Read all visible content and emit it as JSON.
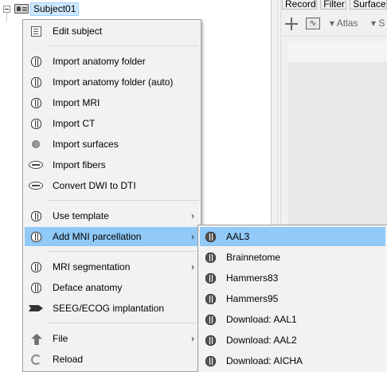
{
  "tree": {
    "subject_label": "Subject01"
  },
  "right_panel": {
    "tabs": [
      "Record",
      "Filter",
      "Surface"
    ],
    "toolbar": {
      "atlas_label": "Atlas",
      "more_label": "S"
    }
  },
  "context_menu": {
    "items": [
      {
        "label": "Edit subject",
        "icon": "edit-icon"
      },
      {
        "label": "Import anatomy folder",
        "icon": "brain-icon"
      },
      {
        "label": "Import anatomy folder (auto)",
        "icon": "brain-icon"
      },
      {
        "label": "Import MRI",
        "icon": "brain-icon"
      },
      {
        "label": "Import CT",
        "icon": "brain-ct-icon"
      },
      {
        "label": "Import surfaces",
        "icon": "surface-icon"
      },
      {
        "label": "Import fibers",
        "icon": "fibers-icon"
      },
      {
        "label": "Convert DWI to DTI",
        "icon": "fibers-icon"
      },
      {
        "label": "Use template",
        "icon": "brain-icon"
      },
      {
        "label": "Add MNI parcellation",
        "icon": "brain-icon"
      },
      {
        "label": "MRI segmentation",
        "icon": "brain-icon"
      },
      {
        "label": "Deface anatomy",
        "icon": "brain-icon"
      },
      {
        "label": "SEEG/ECOG implantation",
        "icon": "seeg-icon"
      },
      {
        "label": "File",
        "icon": "file-icon"
      },
      {
        "label": "Reload",
        "icon": "reload-icon"
      }
    ],
    "submenu_arrow": "›"
  },
  "submenu": {
    "items": [
      {
        "label": "AAL3",
        "icon": "brain-icon"
      },
      {
        "label": "Brainnetome",
        "icon": "brain-icon"
      },
      {
        "label": "Hammers83",
        "icon": "brain-icon"
      },
      {
        "label": "Hammers95",
        "icon": "brain-icon"
      },
      {
        "label": "Download: AAL1",
        "icon": "brain-icon"
      },
      {
        "label": "Download: AAL2",
        "icon": "brain-icon"
      },
      {
        "label": "Download: AICHA",
        "icon": "brain-icon"
      }
    ]
  },
  "colors": {
    "highlight": "#91c9f7",
    "menu_background": "#f2f2f2",
    "selection": "#cde8ff"
  }
}
